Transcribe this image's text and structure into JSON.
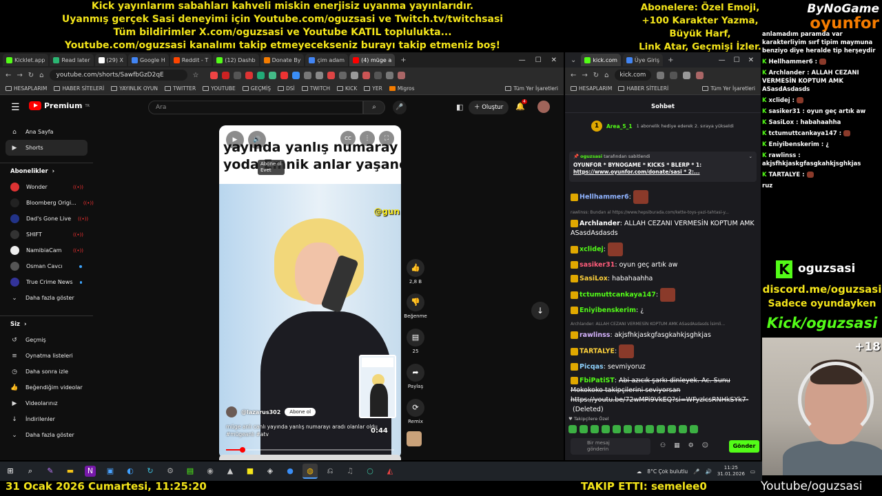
{
  "overlay": {
    "top_left_lines": [
      "Kick yayınlarım sabahları kahveli miskin enerjisiz uyanma yayınlarıdır.",
      "Uyanmış gerçek Sasi deneyimi için Youtube.com/oguzsasi ve Twitch.tv/twitchsasi",
      "Tüm bildirimler X.com/oguzsasi ve Youtube KATIL toplulukta...",
      "Youtube.com/oguzsasi kanalımı takip etmeyecekseniz burayı takip etmeniz boş!"
    ],
    "top_right_lines": [
      "Abonelere: Özel Emoji,",
      "+100 Karakter Yazma,",
      "Büyük Harf,",
      "Link Atar, Geçmişi İzler."
    ],
    "brand_top": "ByNoGame",
    "brand_bottom": "oyunfor",
    "kick_name": "oguzsasi",
    "discord": "discord.me/oguzsasi",
    "only_in_game": "Sadece oyundayken",
    "kick_url": "Kick/oguzsasi",
    "age": "+18",
    "date_time": "31 Ocak 2026 Cumartesi, 11:25:20",
    "follow_alert": "TAKIP ETTI: semelee0",
    "youtube_handle": "Youtube/oguzsasi"
  },
  "left_browser": {
    "tabs": [
      "Kicklet.app",
      "Read later",
      "(29) X",
      "Google H",
      "Reddit - T",
      "(12) Dashb",
      "Donate By",
      "çim adam",
      "(4) müge a"
    ],
    "url": "youtube.com/shorts/SawfbGzD2qE",
    "bookmarks": [
      "HESAPLARIM",
      "HABER SİTELERİ",
      "YAYINLIK OYUN",
      "TWITTER",
      "YOUTUBE",
      "GEÇMİŞ",
      "DSİ",
      "TWITCH",
      "KICK",
      "YER",
      "Migros",
      "Tüm Yer İşaretleri"
    ]
  },
  "youtube": {
    "logo": "Premium",
    "logo_sup": "TR",
    "search_placeholder": "Ara",
    "create": "Oluştur",
    "notif_count": "4",
    "nav": [
      {
        "label": "Ana Sayfa",
        "icon": "home-icon"
      },
      {
        "label": "Shorts",
        "icon": "shorts-icon"
      }
    ],
    "subs_header": "Abonelikler",
    "subs": [
      {
        "label": "Wonder",
        "color": "#d33",
        "live": true
      },
      {
        "label": "Bloomberg Origi...",
        "color": "#222",
        "live": true
      },
      {
        "label": "Dad's Gone Live",
        "color": "#238",
        "live": true
      },
      {
        "label": "SHIFT",
        "color": "#333",
        "live": true
      },
      {
        "label": "NamibiaCam",
        "color": "#eee",
        "live": true
      },
      {
        "label": "Osman Cavcı",
        "color": "#555",
        "live": false
      },
      {
        "label": "True Crime News",
        "color": "#339",
        "live": false
      }
    ],
    "show_more": "Daha fazla göster",
    "you_header": "Siz",
    "you_items": [
      {
        "label": "Geçmiş",
        "icon": "history-icon"
      },
      {
        "label": "Oynatma listeleri",
        "icon": "playlist-icon"
      },
      {
        "label": "Daha sonra izle",
        "icon": "clock-icon"
      },
      {
        "label": "Beğendiğim videolar",
        "icon": "like-icon"
      },
      {
        "label": "Videolarınız",
        "icon": "video-icon"
      },
      {
        "label": "İndirilenler",
        "icon": "download-icon"
      },
      {
        "label": "Daha fazla göster",
        "icon": "chevron-down-icon"
      }
    ],
    "short": {
      "caption_line1": "yayında yanlış numaray",
      "caption_line2": "yoda Emnik anlar yaşanc",
      "watermark": "@gun",
      "popup_line1": "Abone ol",
      "popup_line2": "Evet",
      "channel": "@lazarus302",
      "subscribe": "Abone ol",
      "description": "müge anlı canlı yayında yanlış numarayı aradı olanlar oldu #mügeanlı #atv",
      "time": "0:44",
      "progress": 0.1
    },
    "actions": [
      {
        "icon": "thumbs-up-icon",
        "label": "2,8 B"
      },
      {
        "icon": "thumbs-down-icon",
        "label": "Beğenme"
      },
      {
        "icon": "comment-icon",
        "label": "25"
      },
      {
        "icon": "share-icon",
        "label": "Paylaş"
      },
      {
        "icon": "remix-icon",
        "label": "Remix"
      }
    ]
  },
  "right_browser": {
    "tabs": [
      "kick.com",
      "Üye Giriş"
    ],
    "url": "kick.com",
    "bookmarks": [
      "HESAPLARIM",
      "HABER SİTELERİ",
      "Tüm Yer İşaretleri"
    ],
    "chat_title": "Sohbet",
    "gift_user": "Area_5_1",
    "gift_text": "1 abonelik hediye ederek 2. sıraya yükseldi",
    "pinned_by": "oguzsasi",
    "pinned_by_suffix": "tarafından sabitlendi",
    "pinned_text": "OYUNFOR * BYNOGAME * KICKS * BLERP * 1:",
    "pinned_link": "https://www.oyunfor.com/donate/sasi * 2:...",
    "messages": [
      {
        "user": "Hellhammer6",
        "color": "#8fb3ff",
        "text": "",
        "emote": true
      },
      {
        "reply": "rawlinss: Bundan al https://www.hepsiburada.com/kette-toys-yazi-tahtasi-y...",
        "user": "Archlander",
        "color": "#fff",
        "text": "ALLAH CEZANI VERMESİN KOPTUM AMK ASasdAsdasds"
      },
      {
        "user": "xclidej",
        "color": "#53fc18",
        "text": "",
        "emote": true
      },
      {
        "user": "sasiker31",
        "color": "#ff5c7a",
        "text": "oyun geç artık aw"
      },
      {
        "user": "SasiLox",
        "color": "#ffd23c",
        "text": "habahaahha"
      },
      {
        "user": "tctumuttcankaya147",
        "color": "#53fc18",
        "text": "",
        "emote": true
      },
      {
        "user": "Eniyibenskerim",
        "color": "#53fc18",
        "text": "¿"
      },
      {
        "reply": "Archlander: ALLAH CEZANI VERMESİN KOPTUM AMK ASasdAsdasds İsimli...",
        "user": "rawlinss",
        "color": "#d6b4ff",
        "text": "akjsfhkjaskgfasgkahkjsghkjas"
      },
      {
        "user": "TARTALYE",
        "color": "#ffd23c",
        "text": "",
        "emote": true
      },
      {
        "user": "Picqas",
        "color": "#8fd3ff",
        "text": "sevmiyoruz"
      },
      {
        "user": "FbiPatiST",
        "color": "#53fc18",
        "text": "Abi azıcık şarkı dinleyek. Ac. Sunu Mokokoko takipçilerini seviyorsan https://youtu.be/72wMPi9VkEQ?si=WFyzlcsRNHkSYk7-",
        "deleted": true,
        "deleted_label": "(Deleted)"
      }
    ],
    "followers_only": "Takipçilere Özel",
    "input_placeholder_1": "Bir mesaj",
    "input_placeholder_2": "gönderin",
    "send": "Gönder"
  },
  "overlay_chat": [
    {
      "user": "",
      "text": "anlamadım paramda var karakterliyim sırf tipim maymuna benziyo diye heralde tip herşeydir"
    },
    {
      "user": "Hellhammer6 :",
      "text": ""
    },
    {
      "user": "Archlander :",
      "text": "ALLAH CEZANI VERMESİN KOPTUM AMK ASasdAsdasds"
    },
    {
      "user": "xclidej :",
      "text": ""
    },
    {
      "user": "sasiker31 :",
      "text": "oyun geç artık aw"
    },
    {
      "user": "SasiLox :",
      "text": "habahaahha"
    },
    {
      "user": "tctumuttcankaya147 :",
      "text": ""
    },
    {
      "user": "Eniyibenskerim :",
      "text": "¿"
    },
    {
      "user": "rawlinss :",
      "text": "akjsfhkjaskgfasgkahkjsghkjas"
    },
    {
      "user": "TARTALYE :",
      "text": ""
    },
    {
      "user": "",
      "text": "ruz"
    }
  ],
  "taskbar": {
    "weather": "8°C  Çok bulutlu",
    "time": "11:25",
    "date": "31.01.2026"
  },
  "colors": {
    "overlay_yellow": "#f4e51a",
    "kick_green": "#53fc18",
    "youtube_red": "#ff0000"
  }
}
